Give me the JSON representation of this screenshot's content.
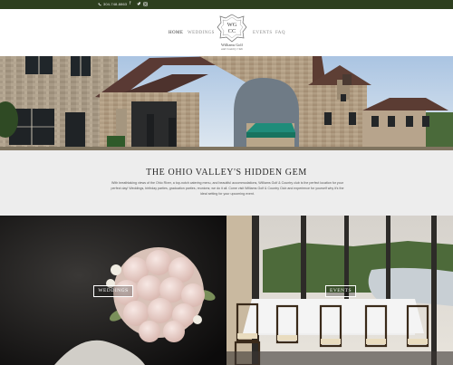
{
  "topbar": {
    "phone": "304-748-8863",
    "social": [
      "f",
      "t",
      "ig"
    ]
  },
  "nav": {
    "left": [
      "HOME",
      "WEDDINGS"
    ],
    "right": [
      "EVENTS",
      "FAQ"
    ]
  },
  "logo": {
    "monogram": "WG CC",
    "name": "Williams Golf",
    "tagline": "and Country Club"
  },
  "intro": {
    "heading": "THE OHIO VALLEY'S HIDDEN GEM",
    "body": "With breathtaking views of the Ohio River, a top-notch catering menu, and beautiful accommodations, Williams Golf & Country club is the perfect location for your perfect day! Weddings, birthday parties, graduation parties, reunions; we do it all. Come visit Williams Golf & Country Club and experience for yourself why it's the ideal setting for your upcoming event."
  },
  "tiles": [
    {
      "label": "WEDDINGS"
    },
    {
      "label": "EVENTS"
    }
  ],
  "colors": {
    "topbar": "#2d3f1e",
    "intro_bg": "#ededed",
    "awning": "#1f8c7a"
  }
}
